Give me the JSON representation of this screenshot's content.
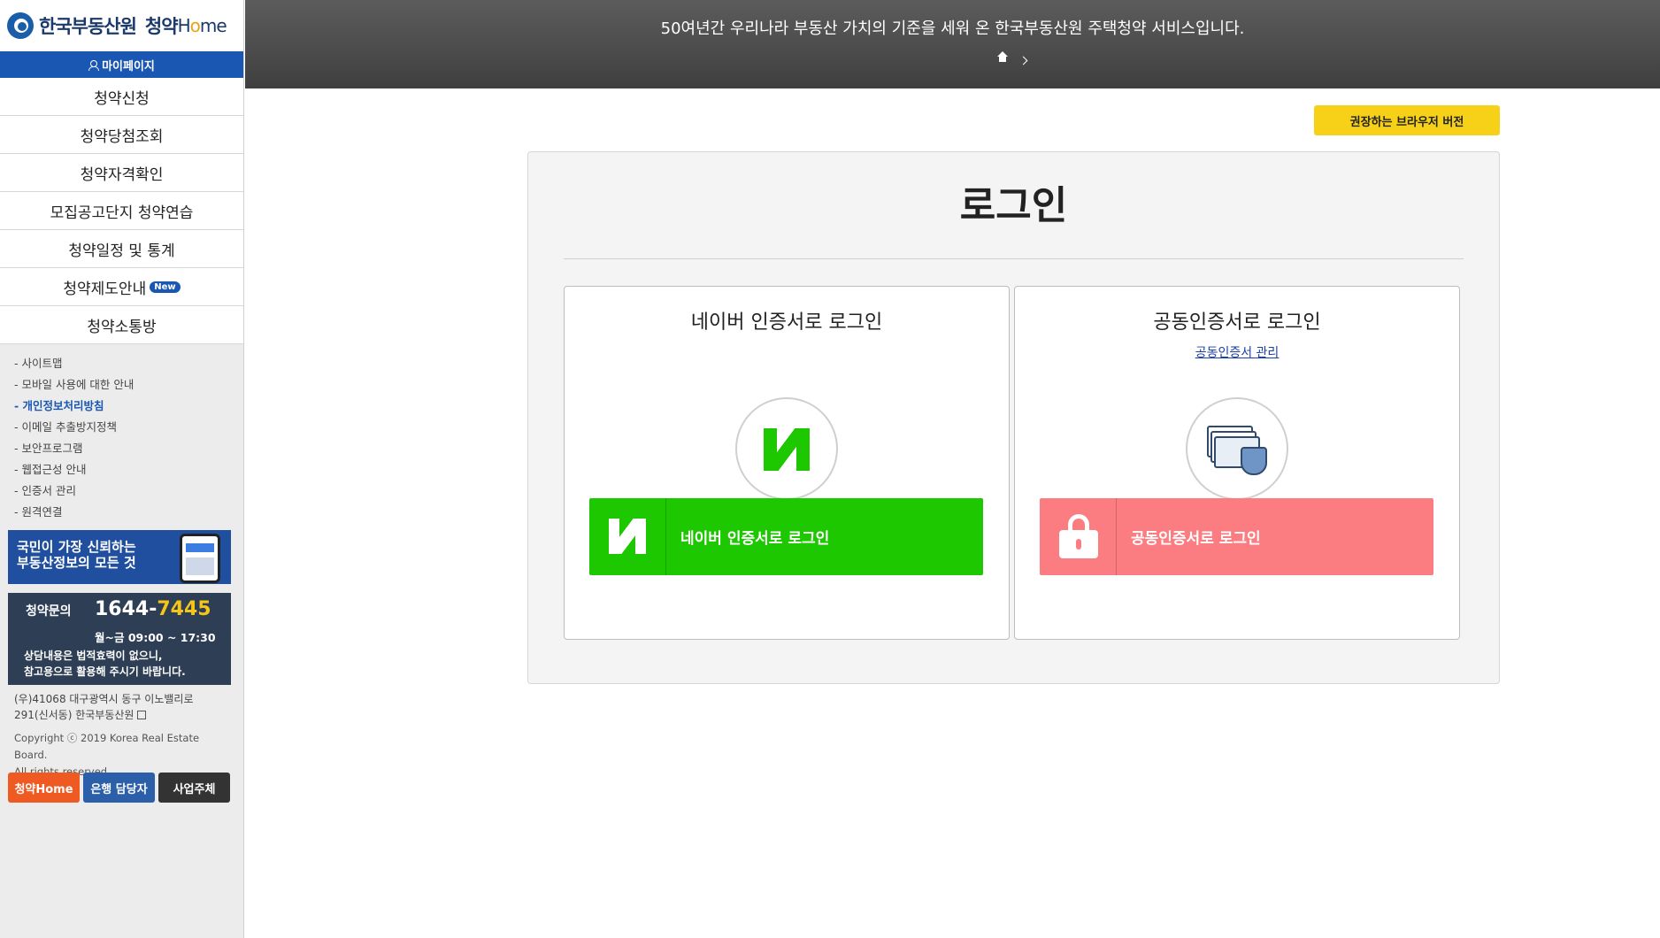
{
  "sidebar": {
    "logo_org": "한국부동산원",
    "logo_brand": "청약",
    "logo_brand_home_prefix": "H",
    "logo_brand_home_o": "o",
    "logo_brand_home_suffix": "me",
    "mypage_label": "마이페이지",
    "menu": [
      {
        "label": "청약신청"
      },
      {
        "label": "청약당첨조회"
      },
      {
        "label": "청약자격확인"
      },
      {
        "label": "모집공고단지 청약연습"
      },
      {
        "label": "청약일정 및 통계"
      },
      {
        "label": "청약제도안내",
        "badge": "New"
      },
      {
        "label": "청약소통방"
      }
    ],
    "links": [
      "- 사이트맵",
      "- 모바일 사용에 대한 안내",
      "- 개인정보처리방침",
      "- 이메일 추출방지정책",
      "- 보안프로그램",
      "- 웹접근성 안내",
      "- 인증서 관리",
      "- 원격연결"
    ],
    "promo_line1": "국민이 가장 신뢰하는",
    "promo_line2": "부동산정보의 모든 것",
    "contact_label": "청약문의",
    "contact_tel_prefix": "1644-",
    "contact_tel_suffix": "7445",
    "contact_hours": "월~금 09:00 ~ 17:30",
    "contact_note1": "상담내용은 법적효력이 없으니,",
    "contact_note2": "참고용으로 활용해 주시기 바랍니다.",
    "address_line1": "(우)41068 대구광역시 동구 이노밸리로",
    "address_line2": "291(신서동) 한국부동산원",
    "copyright_line1": "Copyright ⓒ 2019 Korea Real Estate Board.",
    "copyright_line2": "All rights reserved.",
    "buttons": [
      "청약Home",
      "은행 담당자",
      "사업주체"
    ]
  },
  "topbar": {
    "message": "50여년간 우리나라 부동산 가치의 기준을 세워 온 한국부동산원 주택청약 서비스입니다."
  },
  "main": {
    "browser_button": "권장하는 브라우저 버전",
    "title": "로그인",
    "naver": {
      "title": "네이버 인증서로 로그인",
      "button": "네이버 인증서로 로그인"
    },
    "cert": {
      "title": "공동인증서로 로그인",
      "manage_link": "공동인증서 관리",
      "button": "공동인증서로 로그인"
    }
  },
  "colors": {
    "sidebar_accent": "#1a57b3",
    "naver_green": "#1ec800",
    "cert_pink": "#fb7c81",
    "browser_yellow": "#f7d117"
  }
}
